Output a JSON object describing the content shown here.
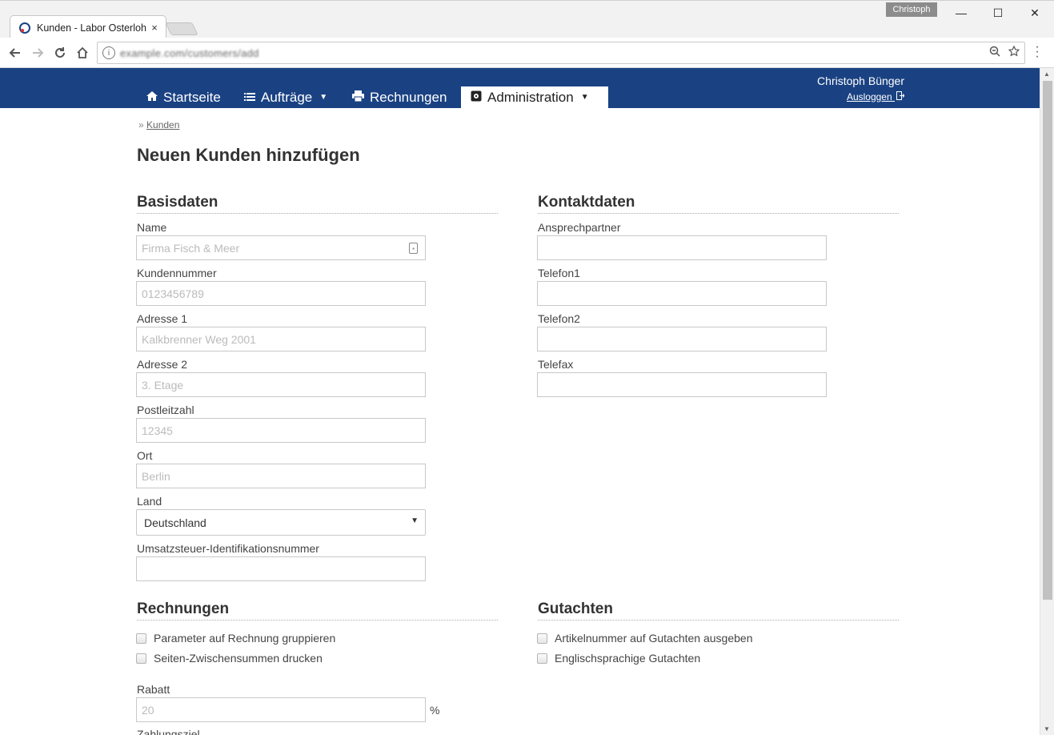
{
  "browser": {
    "tab_title": "Kunden - Labor Osterloh",
    "tab_close": "×",
    "profile": "Christoph",
    "url": "example.com/customers/add",
    "window_controls": {
      "minimize": "—",
      "maximize": "☐",
      "close": "✕"
    },
    "icons": [
      "back-icon",
      "forward-icon",
      "reload-icon",
      "home-icon",
      "zoom-icon",
      "bookmark-star-icon",
      "menu-icon"
    ]
  },
  "nav": {
    "items": [
      {
        "label": "Startseite",
        "icon": "home-icon"
      },
      {
        "label": "Aufträge",
        "icon": "list-icon",
        "has_dropdown": true
      },
      {
        "label": "Rechnungen",
        "icon": "printer-icon"
      },
      {
        "label": "Administration",
        "icon": "admin-icon",
        "has_dropdown": true,
        "active": true
      }
    ],
    "user": "Christoph Bünger",
    "logout": "Ausloggen"
  },
  "breadcrumb": {
    "separator": "»",
    "link": "Kunden"
  },
  "page_title": "Neuen Kunden hinzufügen",
  "basisdaten": {
    "title": "Basisdaten",
    "name": {
      "label": "Name",
      "placeholder": "Firma Fisch & Meer"
    },
    "kundennummer": {
      "label": "Kundennummer",
      "placeholder": "0123456789"
    },
    "adresse1": {
      "label": "Adresse 1",
      "placeholder": "Kalkbrenner Weg 2001"
    },
    "adresse2": {
      "label": "Adresse 2",
      "placeholder": "3. Etage"
    },
    "plz": {
      "label": "Postleitzahl",
      "placeholder": "12345"
    },
    "ort": {
      "label": "Ort",
      "placeholder": "Berlin"
    },
    "land": {
      "label": "Land",
      "value": "Deutschland"
    },
    "ust": {
      "label": "Umsatzsteuer-Identifikationsnummer",
      "placeholder": ""
    }
  },
  "kontaktdaten": {
    "title": "Kontaktdaten",
    "ansprechpartner": {
      "label": "Ansprechpartner"
    },
    "telefon1": {
      "label": "Telefon1"
    },
    "telefon2": {
      "label": "Telefon2"
    },
    "telefax": {
      "label": "Telefax"
    }
  },
  "rechnungen": {
    "title": "Rechnungen",
    "check1": "Parameter auf Rechnung gruppieren",
    "check2": "Seiten-Zwischensummen drucken",
    "rabatt": {
      "label": "Rabatt",
      "placeholder": "20",
      "unit": "%"
    },
    "zahlungsziel": {
      "label": "Zahlungsziel"
    }
  },
  "gutachten": {
    "title": "Gutachten",
    "check1": "Artikelnummer auf Gutachten ausgeben",
    "check2": "Englischsprachige Gutachten"
  },
  "colors": {
    "nav_bg": "#1a4283",
    "page_bg": "#ffffff"
  }
}
